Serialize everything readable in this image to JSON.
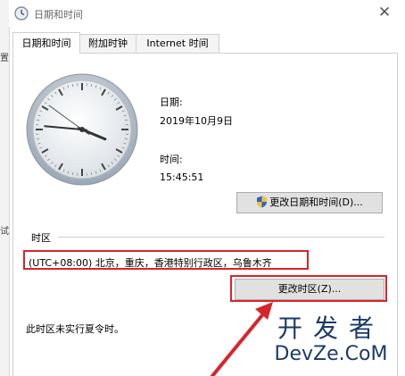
{
  "window": {
    "title": "日期和时间",
    "close_glyph": "✕"
  },
  "left_edge": {
    "fragments": [
      "置",
      "试"
    ]
  },
  "tabs": [
    {
      "label": "日期和时间",
      "active": true
    },
    {
      "label": "附加时钟",
      "active": false
    },
    {
      "label": "Internet 时间",
      "active": false
    }
  ],
  "clock": {
    "hour": 15,
    "minute": 45,
    "second": 51
  },
  "date": {
    "label": "日期:",
    "value": "2019年10月9日"
  },
  "time": {
    "label": "时间:",
    "value": "15:45:51"
  },
  "buttons": {
    "change_datetime": "更改日期和时间(D)...",
    "change_datetime_icon": "uac-shield-icon",
    "change_timezone": "更改时区(Z)..."
  },
  "timezone": {
    "section_label": "时区",
    "value": "(UTC+08:00) 北京，重庆，香港特别行政区，乌鲁木齐",
    "dst_note": "此时区未实行夏令时。"
  },
  "watermark": {
    "top": "开发者",
    "bottom": "DevZe.CoM"
  },
  "colors": {
    "highlight": "#d9242b",
    "watermark": "#1b3a6b"
  }
}
